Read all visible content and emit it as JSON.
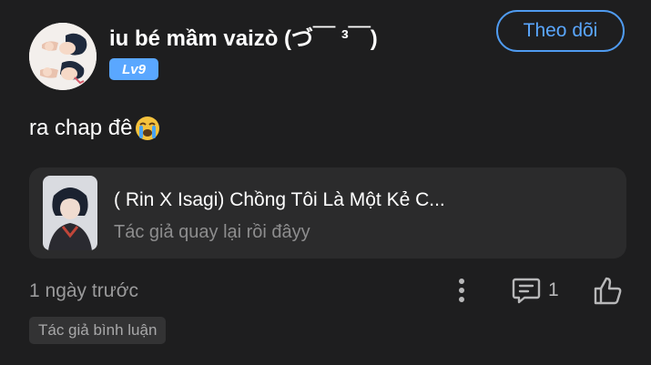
{
  "user": {
    "name": "iu bé mầm vaizò (づ￣ ³￣)",
    "level": "Lv9",
    "follow_label": "Theo dõi"
  },
  "comment": {
    "text": "ra chap đê",
    "emoji": "loudly-crying-face"
  },
  "story": {
    "title": "( Rin X Isagi) Chồng Tôi Là Một Kẻ C...",
    "description": "Tác giả quay lại rồi đâyy"
  },
  "footer": {
    "time": "1 ngày trước",
    "reply_count": "1",
    "author_tag": "Tác giả bình luận"
  },
  "icons": {
    "more": "more-vertical-icon",
    "reply": "comment-icon",
    "like": "thumbs-up-icon"
  },
  "colors": {
    "background": "#1e1e1f",
    "accent": "#5aa7ff",
    "card": "#2b2b2c"
  }
}
